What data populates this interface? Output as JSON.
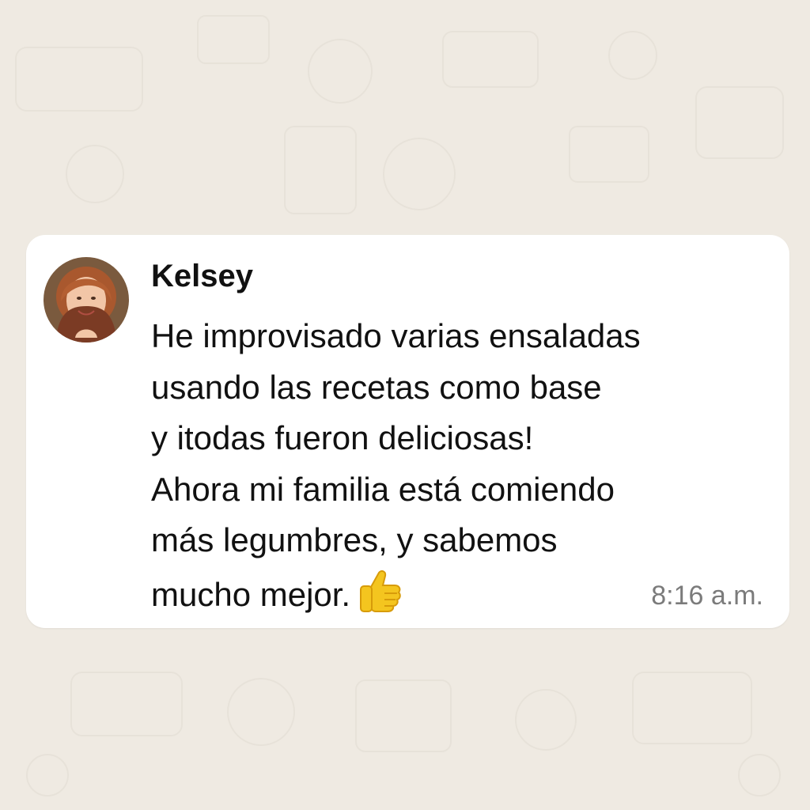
{
  "chat": {
    "wallpaper_color": "#efeae2",
    "bubble_color": "#ffffff"
  },
  "message": {
    "sender": "Kelsey",
    "avatar_icon": "avatar-woman-redhead",
    "lines": [
      "He improvisado varias ensaladas",
      "usando las recetas como base",
      "y itodas fueron deliciosas!",
      "Ahora mi familia está comiendo",
      "más legumbres, y sabemos",
      "mucho mejor."
    ],
    "emoji": "thumbs-up-icon",
    "time": "8:16 a.m."
  }
}
